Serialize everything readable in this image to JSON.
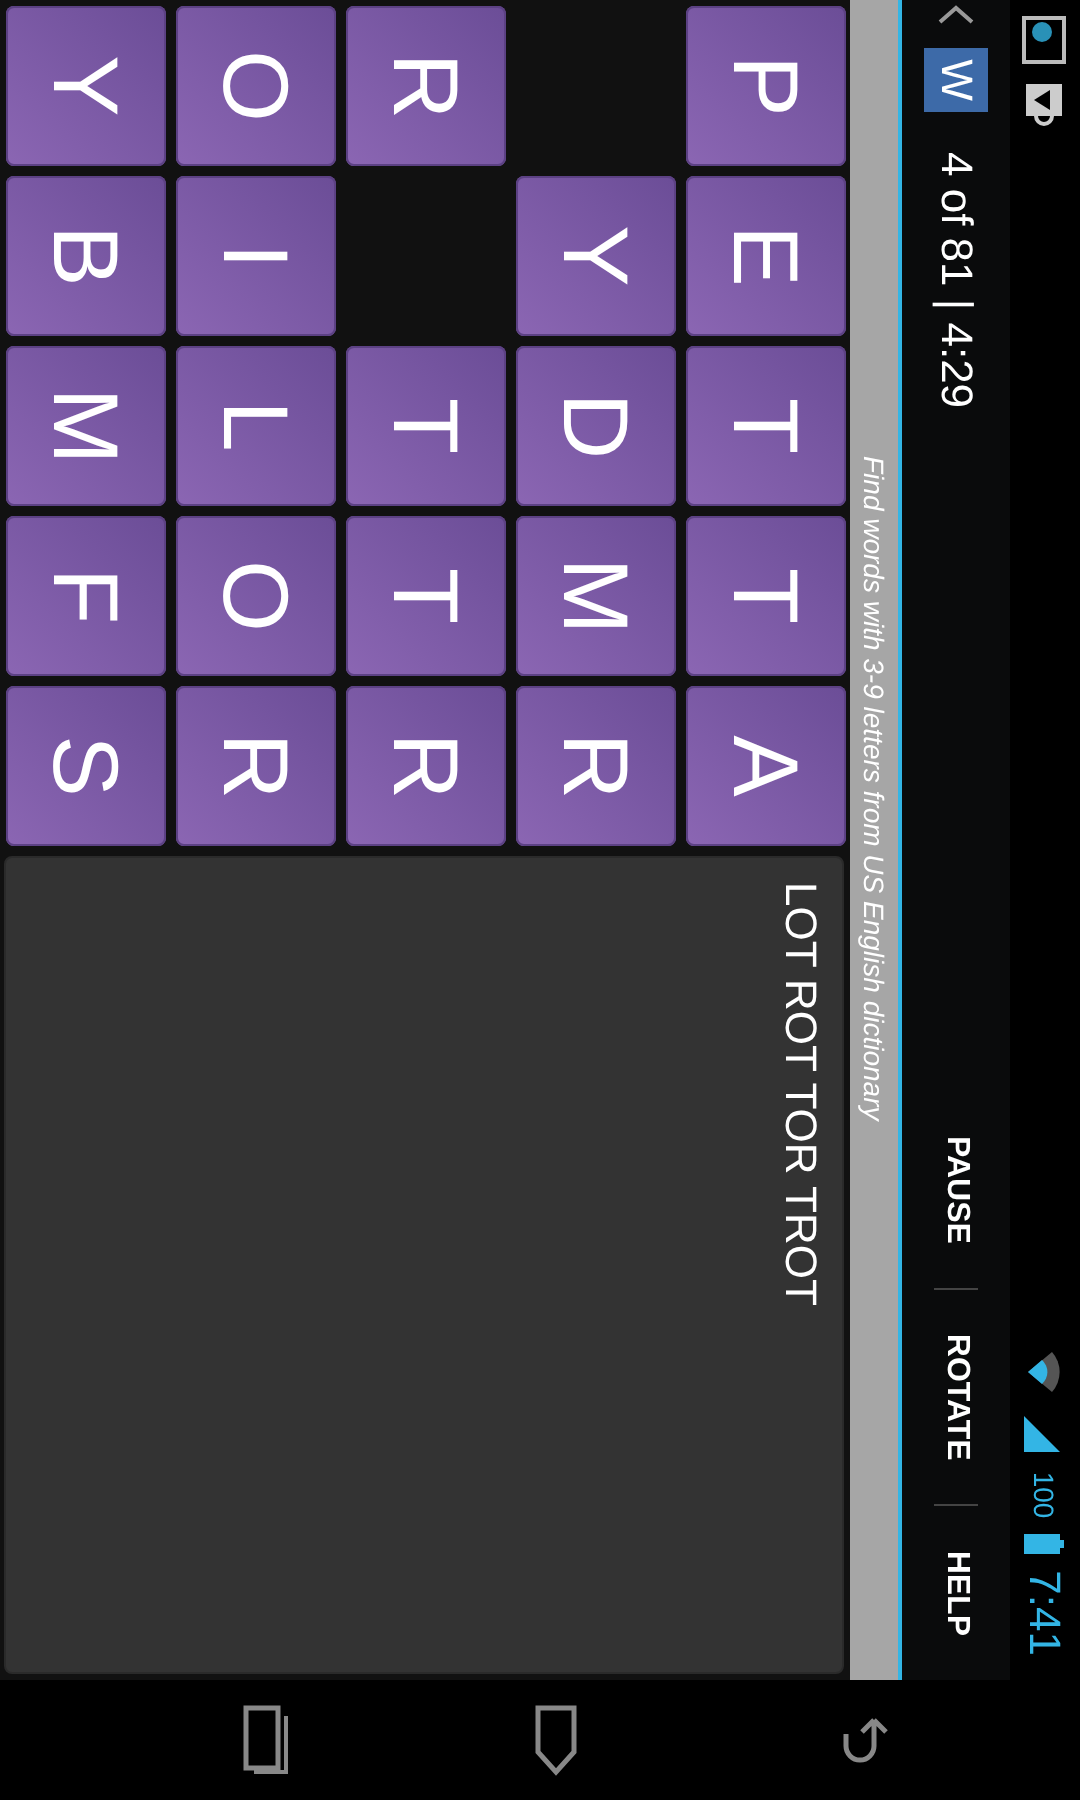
{
  "status_bar": {
    "battery": "100",
    "time": "7:41"
  },
  "action_bar": {
    "logo": "W",
    "title": "4 of 81 | 4:29",
    "actions": [
      "PAUSE",
      "ROTATE",
      "HELP"
    ]
  },
  "hint": "Find words with 3-9 letters from US English dictionary",
  "grid": [
    [
      {
        "kind": "tile",
        "letter": "P"
      },
      {
        "kind": "tile",
        "letter": "E"
      },
      {
        "kind": "tile",
        "letter": "T"
      },
      {
        "kind": "tile",
        "letter": "T"
      },
      {
        "kind": "tile",
        "letter": "A"
      }
    ],
    [
      {
        "kind": "empty"
      },
      {
        "kind": "tile",
        "letter": "Y"
      },
      {
        "kind": "tile",
        "letter": "D"
      },
      {
        "kind": "tile",
        "letter": "M"
      },
      {
        "kind": "tile",
        "letter": "R"
      }
    ],
    [
      {
        "kind": "tile",
        "letter": "R"
      },
      {
        "kind": "empty"
      },
      {
        "kind": "tile",
        "letter": "T"
      },
      {
        "kind": "tile",
        "letter": "T"
      },
      {
        "kind": "tile",
        "letter": "R"
      }
    ],
    [
      {
        "kind": "tile",
        "letter": "O"
      },
      {
        "kind": "tile",
        "letter": "I"
      },
      {
        "kind": "tile",
        "letter": "L"
      },
      {
        "kind": "tile",
        "letter": "O"
      },
      {
        "kind": "tile",
        "letter": "R"
      }
    ],
    [
      {
        "kind": "tile",
        "letter": "Y"
      },
      {
        "kind": "tile",
        "letter": "B"
      },
      {
        "kind": "tile",
        "letter": "M"
      },
      {
        "kind": "tile",
        "letter": "F"
      },
      {
        "kind": "tile",
        "letter": "S"
      }
    ]
  ],
  "found_words": "LOT ROT TOR TROT"
}
